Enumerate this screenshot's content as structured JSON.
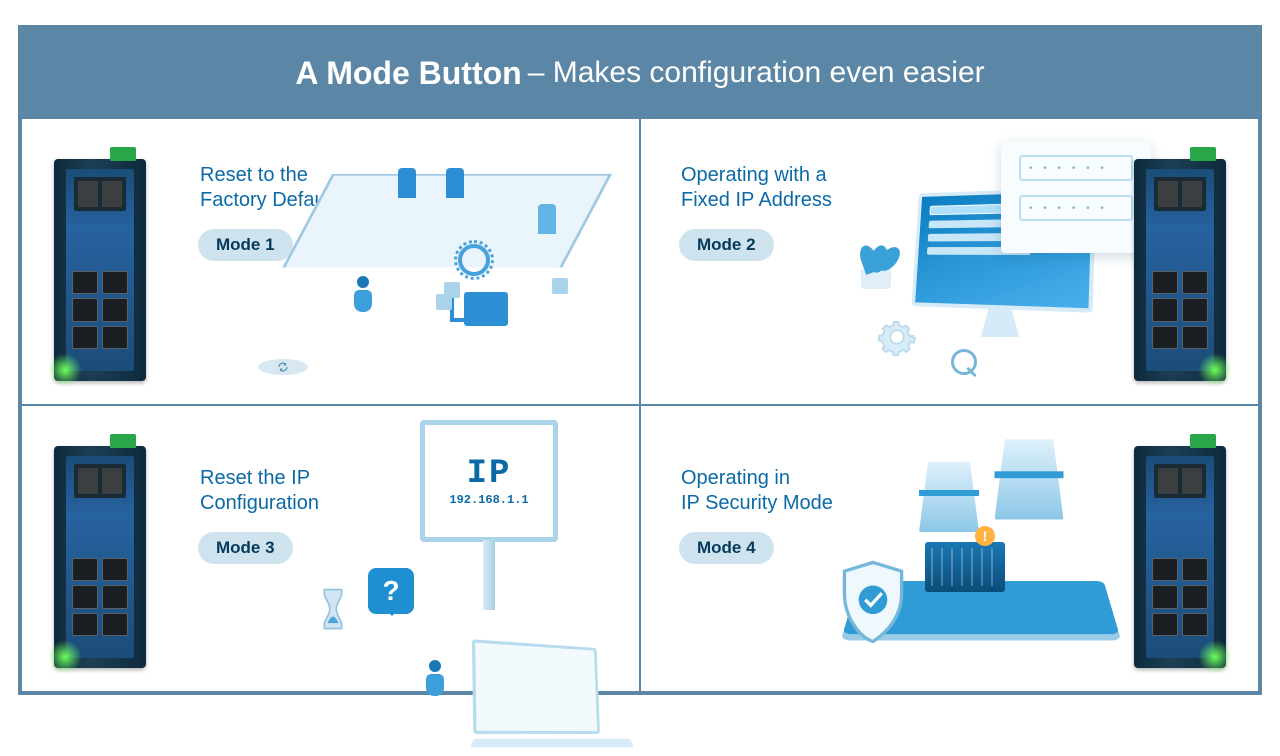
{
  "header": {
    "bold": "A Mode Button",
    "light": "– Makes configuration even easier"
  },
  "modes": [
    {
      "title_line1": "Reset to the",
      "title_line2": "Factory Default",
      "badge": "Mode 1"
    },
    {
      "title_line1": "Operating with a",
      "title_line2": "Fixed IP Address",
      "badge": "Mode 2"
    },
    {
      "title_line1": "Reset the IP",
      "title_line2": "Configuration",
      "badge": "Mode 3"
    },
    {
      "title_line1": "Operating in",
      "title_line2": "IP Security Mode",
      "badge": "Mode 4"
    }
  ],
  "ip_sign": {
    "big": "IP",
    "small": "192.168.1.1"
  },
  "login_card": {
    "dots": "• • • • • •"
  },
  "question_mark": "?",
  "exclaim": "!",
  "colors": {
    "accent": "#5b86a5",
    "link": "#0b6aa6",
    "badge_bg": "#cfe3ef"
  }
}
